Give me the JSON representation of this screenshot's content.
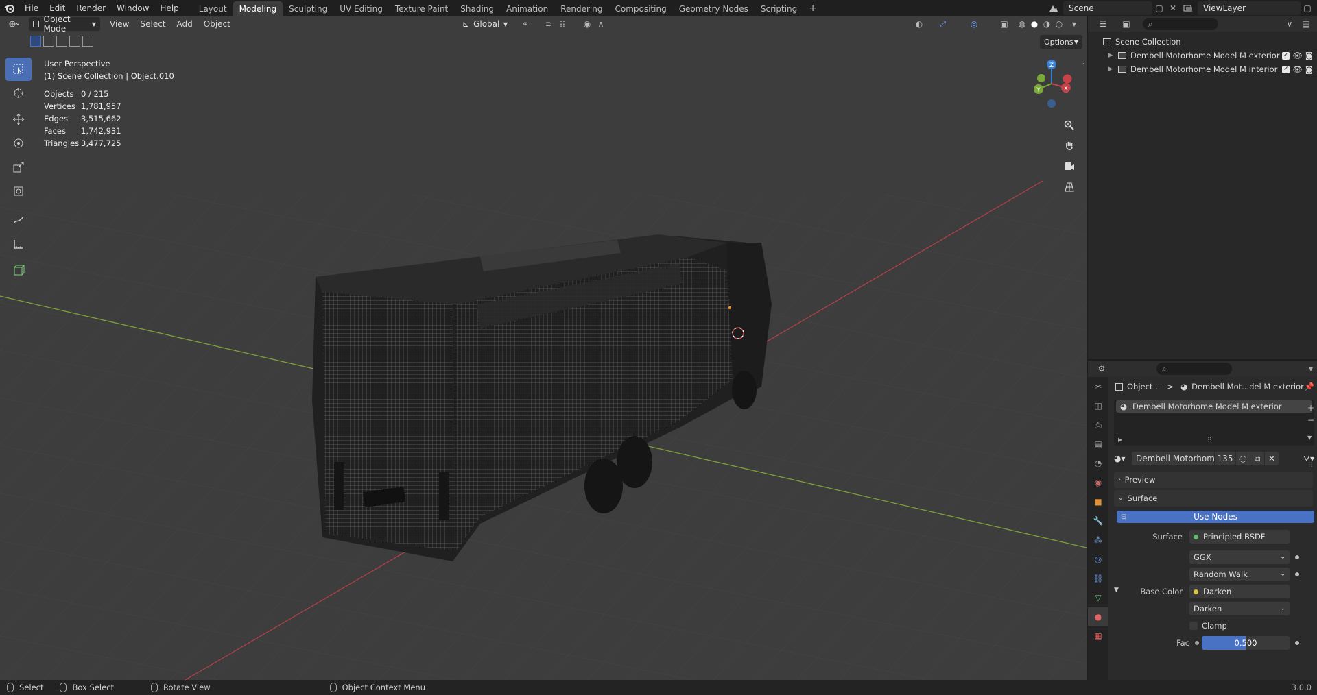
{
  "topbar": {
    "menus": [
      "File",
      "Edit",
      "Render",
      "Window",
      "Help"
    ],
    "workspaces": [
      "Layout",
      "Modeling",
      "Sculpting",
      "UV Editing",
      "Texture Paint",
      "Shading",
      "Animation",
      "Rendering",
      "Compositing",
      "Geometry Nodes",
      "Scripting"
    ],
    "active_workspace": "Modeling",
    "add_workspace": "+",
    "scene": "Scene",
    "view_layer": "ViewLayer"
  },
  "viewport": {
    "mode": "Object Mode",
    "menus": [
      "View",
      "Select",
      "Add",
      "Object"
    ],
    "orientation": "Global",
    "options_label": "Options",
    "view_name": "User Perspective",
    "collection_info": "(1) Scene Collection | Object.010",
    "stats": [
      {
        "label": "Objects",
        "value": "0 / 215"
      },
      {
        "label": "Vertices",
        "value": "1,781,957"
      },
      {
        "label": "Edges",
        "value": "3,515,662"
      },
      {
        "label": "Faces",
        "value": "1,742,931"
      },
      {
        "label": "Triangles",
        "value": "3,477,725"
      }
    ],
    "gizmo": {
      "x": "X",
      "y": "Y",
      "z": "Z"
    }
  },
  "outliner": {
    "root": "Scene Collection",
    "items": [
      {
        "label": "Dembell Motorhome Model M exterior"
      },
      {
        "label": "Dembell Motorhome Model M  interior"
      }
    ]
  },
  "properties": {
    "breadcrumb_object": "Object...",
    "breadcrumb_sep": ">",
    "breadcrumb_material": "Dembell Mot...del M exterior",
    "material_slot": "Dembell Motorhome Model M exterior",
    "material_name": "Dembell Motorhome ...",
    "user_count": "135",
    "preview_label": "Preview",
    "surface_panel": "Surface",
    "use_nodes": "Use Nodes",
    "surface_label": "Surface",
    "surface_value": "Principled BSDF",
    "distribution": "GGX",
    "subsurface": "Random Walk",
    "base_color_label": "Base Color",
    "base_color_value": "Darken",
    "blend_mode": "Darken",
    "clamp_label": "Clamp",
    "fac_label": "Fac",
    "fac_value": "0.500",
    "fac_fraction": 0.5
  },
  "statusbar": {
    "select": "Select",
    "box_select": "Box Select",
    "rotate_view": "Rotate View",
    "context_menu": "Object Context Menu",
    "version": "3.0.0"
  },
  "colors": {
    "accent": "#4a72c4",
    "x_axis": "#c8424a",
    "y_axis": "#7ba83a",
    "z_axis": "#3b7fd1"
  }
}
